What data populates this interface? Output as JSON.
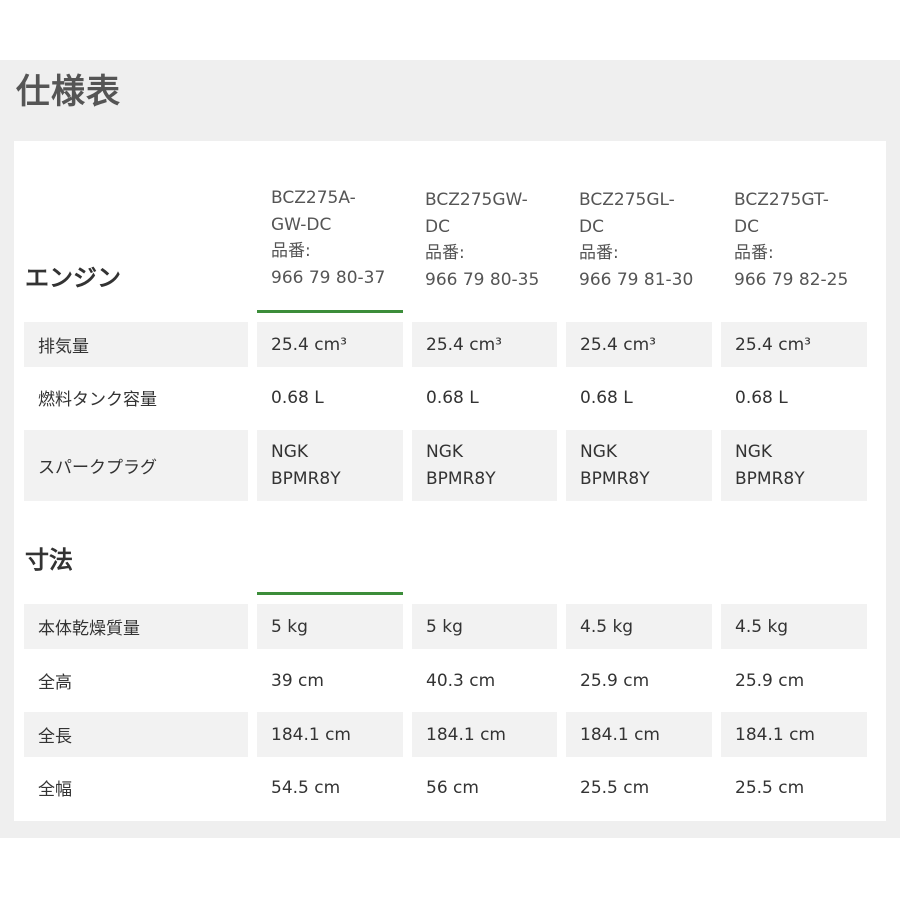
{
  "page_title": "仕様表",
  "columns": [
    {
      "model": "BCZ275A-\nGW-DC",
      "part_label": "品番:",
      "part_number": "966 79 80-37"
    },
    {
      "model": "BCZ275GW-\nDC",
      "part_label": "品番:",
      "part_number": "966 79 80-35"
    },
    {
      "model": "BCZ275GL-\nDC",
      "part_label": "品番:",
      "part_number": "966 79 81-30"
    },
    {
      "model": "BCZ275GT-\nDC",
      "part_label": "品番:",
      "part_number": "966 79 82-25"
    }
  ],
  "sections": [
    {
      "title": "エンジン",
      "rows": [
        {
          "label": "排気量",
          "values": [
            "25.4 cm³",
            "25.4 cm³",
            "25.4 cm³",
            "25.4 cm³"
          ]
        },
        {
          "label": "燃料タンク容量",
          "values": [
            "0.68 L",
            "0.68 L",
            "0.68 L",
            "0.68 L"
          ]
        },
        {
          "label": "スパークプラグ",
          "values": [
            "NGK\nBPMR8Y",
            "NGK\nBPMR8Y",
            "NGK\nBPMR8Y",
            "NGK\nBPMR8Y"
          ]
        }
      ]
    },
    {
      "title": "寸法",
      "rows": [
        {
          "label": "本体乾燥質量",
          "values": [
            "5 kg",
            "5 kg",
            "4.5 kg",
            "4.5 kg"
          ]
        },
        {
          "label": "全高",
          "values": [
            "39 cm",
            "40.3 cm",
            "25.9 cm",
            "25.9 cm"
          ]
        },
        {
          "label": "全長",
          "values": [
            "184.1 cm",
            "184.1 cm",
            "184.1 cm",
            "184.1 cm"
          ]
        },
        {
          "label": "全幅",
          "values": [
            "54.5 cm",
            "56 cm",
            "25.5 cm",
            "25.5 cm"
          ]
        }
      ]
    }
  ]
}
